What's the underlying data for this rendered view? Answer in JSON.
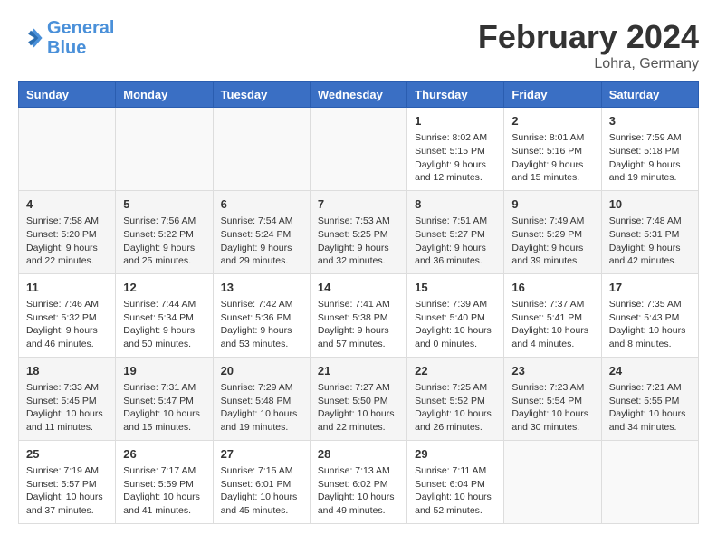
{
  "header": {
    "logo_general": "General",
    "logo_blue": "Blue",
    "main_title": "February 2024",
    "subtitle": "Lohra, Germany"
  },
  "days_of_week": [
    "Sunday",
    "Monday",
    "Tuesday",
    "Wednesday",
    "Thursday",
    "Friday",
    "Saturday"
  ],
  "weeks": [
    [
      {
        "day": "",
        "info": ""
      },
      {
        "day": "",
        "info": ""
      },
      {
        "day": "",
        "info": ""
      },
      {
        "day": "",
        "info": ""
      },
      {
        "day": "1",
        "info": "Sunrise: 8:02 AM\nSunset: 5:15 PM\nDaylight: 9 hours\nand 12 minutes."
      },
      {
        "day": "2",
        "info": "Sunrise: 8:01 AM\nSunset: 5:16 PM\nDaylight: 9 hours\nand 15 minutes."
      },
      {
        "day": "3",
        "info": "Sunrise: 7:59 AM\nSunset: 5:18 PM\nDaylight: 9 hours\nand 19 minutes."
      }
    ],
    [
      {
        "day": "4",
        "info": "Sunrise: 7:58 AM\nSunset: 5:20 PM\nDaylight: 9 hours\nand 22 minutes."
      },
      {
        "day": "5",
        "info": "Sunrise: 7:56 AM\nSunset: 5:22 PM\nDaylight: 9 hours\nand 25 minutes."
      },
      {
        "day": "6",
        "info": "Sunrise: 7:54 AM\nSunset: 5:24 PM\nDaylight: 9 hours\nand 29 minutes."
      },
      {
        "day": "7",
        "info": "Sunrise: 7:53 AM\nSunset: 5:25 PM\nDaylight: 9 hours\nand 32 minutes."
      },
      {
        "day": "8",
        "info": "Sunrise: 7:51 AM\nSunset: 5:27 PM\nDaylight: 9 hours\nand 36 minutes."
      },
      {
        "day": "9",
        "info": "Sunrise: 7:49 AM\nSunset: 5:29 PM\nDaylight: 9 hours\nand 39 minutes."
      },
      {
        "day": "10",
        "info": "Sunrise: 7:48 AM\nSunset: 5:31 PM\nDaylight: 9 hours\nand 42 minutes."
      }
    ],
    [
      {
        "day": "11",
        "info": "Sunrise: 7:46 AM\nSunset: 5:32 PM\nDaylight: 9 hours\nand 46 minutes."
      },
      {
        "day": "12",
        "info": "Sunrise: 7:44 AM\nSunset: 5:34 PM\nDaylight: 9 hours\nand 50 minutes."
      },
      {
        "day": "13",
        "info": "Sunrise: 7:42 AM\nSunset: 5:36 PM\nDaylight: 9 hours\nand 53 minutes."
      },
      {
        "day": "14",
        "info": "Sunrise: 7:41 AM\nSunset: 5:38 PM\nDaylight: 9 hours\nand 57 minutes."
      },
      {
        "day": "15",
        "info": "Sunrise: 7:39 AM\nSunset: 5:40 PM\nDaylight: 10 hours\nand 0 minutes."
      },
      {
        "day": "16",
        "info": "Sunrise: 7:37 AM\nSunset: 5:41 PM\nDaylight: 10 hours\nand 4 minutes."
      },
      {
        "day": "17",
        "info": "Sunrise: 7:35 AM\nSunset: 5:43 PM\nDaylight: 10 hours\nand 8 minutes."
      }
    ],
    [
      {
        "day": "18",
        "info": "Sunrise: 7:33 AM\nSunset: 5:45 PM\nDaylight: 10 hours\nand 11 minutes."
      },
      {
        "day": "19",
        "info": "Sunrise: 7:31 AM\nSunset: 5:47 PM\nDaylight: 10 hours\nand 15 minutes."
      },
      {
        "day": "20",
        "info": "Sunrise: 7:29 AM\nSunset: 5:48 PM\nDaylight: 10 hours\nand 19 minutes."
      },
      {
        "day": "21",
        "info": "Sunrise: 7:27 AM\nSunset: 5:50 PM\nDaylight: 10 hours\nand 22 minutes."
      },
      {
        "day": "22",
        "info": "Sunrise: 7:25 AM\nSunset: 5:52 PM\nDaylight: 10 hours\nand 26 minutes."
      },
      {
        "day": "23",
        "info": "Sunrise: 7:23 AM\nSunset: 5:54 PM\nDaylight: 10 hours\nand 30 minutes."
      },
      {
        "day": "24",
        "info": "Sunrise: 7:21 AM\nSunset: 5:55 PM\nDaylight: 10 hours\nand 34 minutes."
      }
    ],
    [
      {
        "day": "25",
        "info": "Sunrise: 7:19 AM\nSunset: 5:57 PM\nDaylight: 10 hours\nand 37 minutes."
      },
      {
        "day": "26",
        "info": "Sunrise: 7:17 AM\nSunset: 5:59 PM\nDaylight: 10 hours\nand 41 minutes."
      },
      {
        "day": "27",
        "info": "Sunrise: 7:15 AM\nSunset: 6:01 PM\nDaylight: 10 hours\nand 45 minutes."
      },
      {
        "day": "28",
        "info": "Sunrise: 7:13 AM\nSunset: 6:02 PM\nDaylight: 10 hours\nand 49 minutes."
      },
      {
        "day": "29",
        "info": "Sunrise: 7:11 AM\nSunset: 6:04 PM\nDaylight: 10 hours\nand 52 minutes."
      },
      {
        "day": "",
        "info": ""
      },
      {
        "day": "",
        "info": ""
      }
    ]
  ]
}
